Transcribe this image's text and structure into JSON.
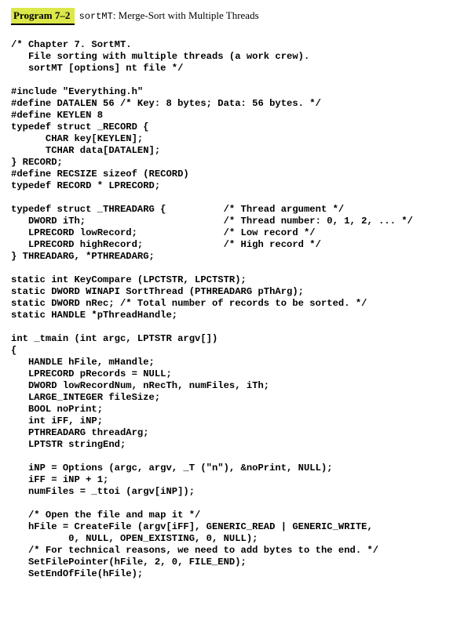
{
  "header": {
    "label": "Program 7–2",
    "cmd": "sortMT",
    "sep": ":",
    "desc": "Merge-Sort with Multiple Threads"
  },
  "code": "/* Chapter 7. SortMT.\n   File sorting with multiple threads (a work crew).\n   sortMT [options] nt file */\n\n#include \"Everything.h\"\n#define DATALEN 56 /* Key: 8 bytes; Data: 56 bytes. */\n#define KEYLEN 8\ntypedef struct _RECORD {\n      CHAR key[KEYLEN];\n      TCHAR data[DATALEN];\n} RECORD;\n#define RECSIZE sizeof (RECORD)\ntypedef RECORD * LPRECORD;\n\ntypedef struct _THREADARG {          /* Thread argument */\n   DWORD iTh;                        /* Thread number: 0, 1, 2, ... */\n   LPRECORD lowRecord;               /* Low record */\n   LPRECORD highRecord;              /* High record */\n} THREADARG, *PTHREADARG;\n\nstatic int KeyCompare (LPCTSTR, LPCTSTR);\nstatic DWORD WINAPI SortThread (PTHREADARG pThArg);\nstatic DWORD nRec; /* Total number of records to be sorted. */\nstatic HANDLE *pThreadHandle;\n\nint _tmain (int argc, LPTSTR argv[])\n{\n   HANDLE hFile, mHandle;\n   LPRECORD pRecords = NULL;\n   DWORD lowRecordNum, nRecTh, numFiles, iTh;\n   LARGE_INTEGER fileSize;\n   BOOL noPrint;\n   int iFF, iNP;\n   PTHREADARG threadArg;\n   LPTSTR stringEnd;\n\n   iNP = Options (argc, argv, _T (\"n\"), &noPrint, NULL);\n   iFF = iNP + 1;\n   numFiles = _ttoi (argv[iNP]);\n\n   /* Open the file and map it */\n   hFile = CreateFile (argv[iFF], GENERIC_READ | GENERIC_WRITE,\n          0, NULL, OPEN_EXISTING, 0, NULL);\n   /* For technical reasons, we need to add bytes to the end. */\n   SetFilePointer(hFile, 2, 0, FILE_END);\n   SetEndOfFile(hFile);"
}
